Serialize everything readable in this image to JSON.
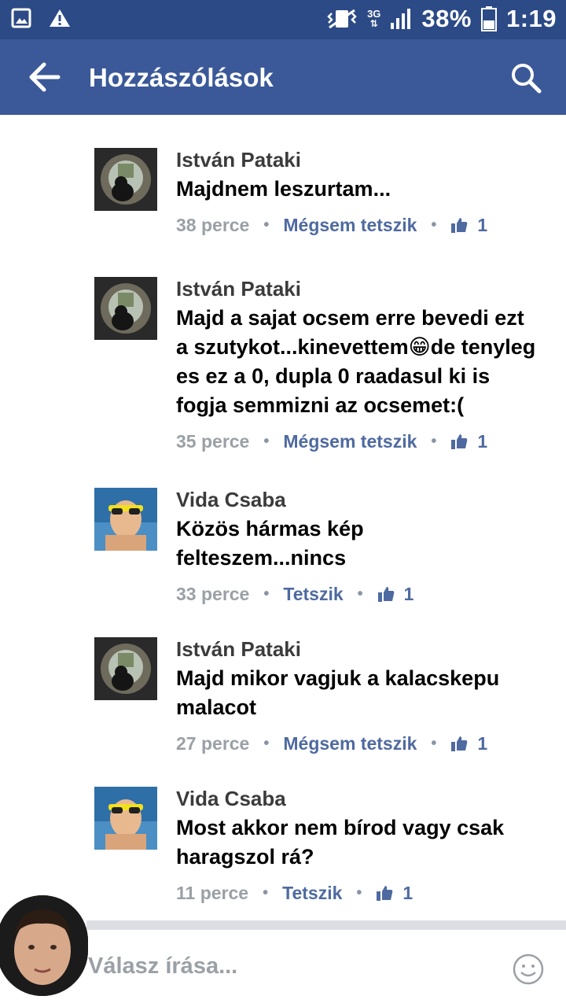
{
  "status_bar": {
    "network": "3G",
    "battery": "38%",
    "time": "1:19"
  },
  "app_bar": {
    "title": "Hozzászólások"
  },
  "comments": [
    {
      "author": "István Pataki",
      "text": "Majdnem leszurtam...",
      "time": "38 perce",
      "like_action": "Mégsem tetszik",
      "likes": "1"
    },
    {
      "author": "István Pataki",
      "text": "Majd a sajat ocsem erre bevedi ezt a szutykot...kinevettem😁de tenyleg es ez a 0, dupla 0 raadasul ki is fogja semmizni az ocsemet:(",
      "time": "35 perce",
      "like_action": "Mégsem tetszik",
      "likes": "1"
    },
    {
      "author": "Vida Csaba",
      "text": "Közös hármas kép felteszem...nincs",
      "time": "33 perce",
      "like_action": "Tetszik",
      "likes": "1"
    },
    {
      "author": "István Pataki",
      "text": "Majd mikor vagjuk a kalacskepu malacot",
      "time": "27 perce",
      "like_action": "Mégsem tetszik",
      "likes": "1"
    },
    {
      "author": "Vida Csaba",
      "text": "Most akkor nem bírod vagy csak haragszol rá?",
      "time": "11 perce",
      "like_action": "Tetszik",
      "likes": "1"
    }
  ],
  "reply": {
    "placeholder": "Válasz írása..."
  },
  "colors": {
    "status_bar": "#2c4a86",
    "app_bar": "#3b5998",
    "link": "#4f6aa0",
    "muted": "#9aa0a6"
  }
}
